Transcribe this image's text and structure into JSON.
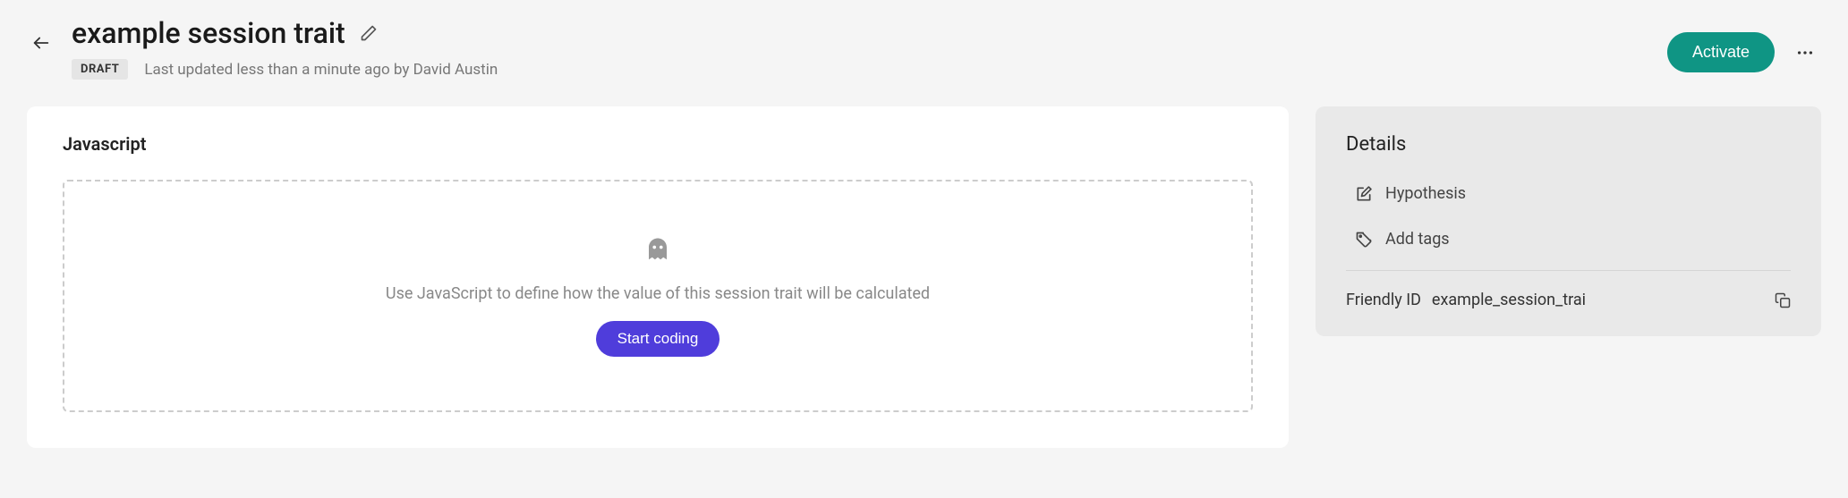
{
  "header": {
    "title": "example session trait",
    "status_badge": "DRAFT",
    "updated_text": "Last updated less than a minute ago by David Austin",
    "activate_label": "Activate"
  },
  "main": {
    "card_title": "Javascript",
    "empty_text": "Use JavaScript to define how the value of this session trait will be calculated",
    "start_coding_label": "Start coding"
  },
  "details": {
    "title": "Details",
    "hypothesis_label": "Hypothesis",
    "add_tags_label": "Add tags",
    "friendly_id_label": "Friendly ID",
    "friendly_id_value": "example_session_trai"
  },
  "icons": {
    "back": "arrow-left-icon",
    "edit": "pencil-icon",
    "more": "more-horizontal-icon",
    "ghost": "ghost-icon",
    "hypothesis": "edit-note-icon",
    "tag": "tag-icon",
    "copy": "copy-icon"
  },
  "colors": {
    "accent_primary": "#0f9584",
    "accent_secondary": "#4f3ddb",
    "bg": "#f5f5f5",
    "card_bg": "#ffffff",
    "side_bg": "#e9e9e9"
  }
}
